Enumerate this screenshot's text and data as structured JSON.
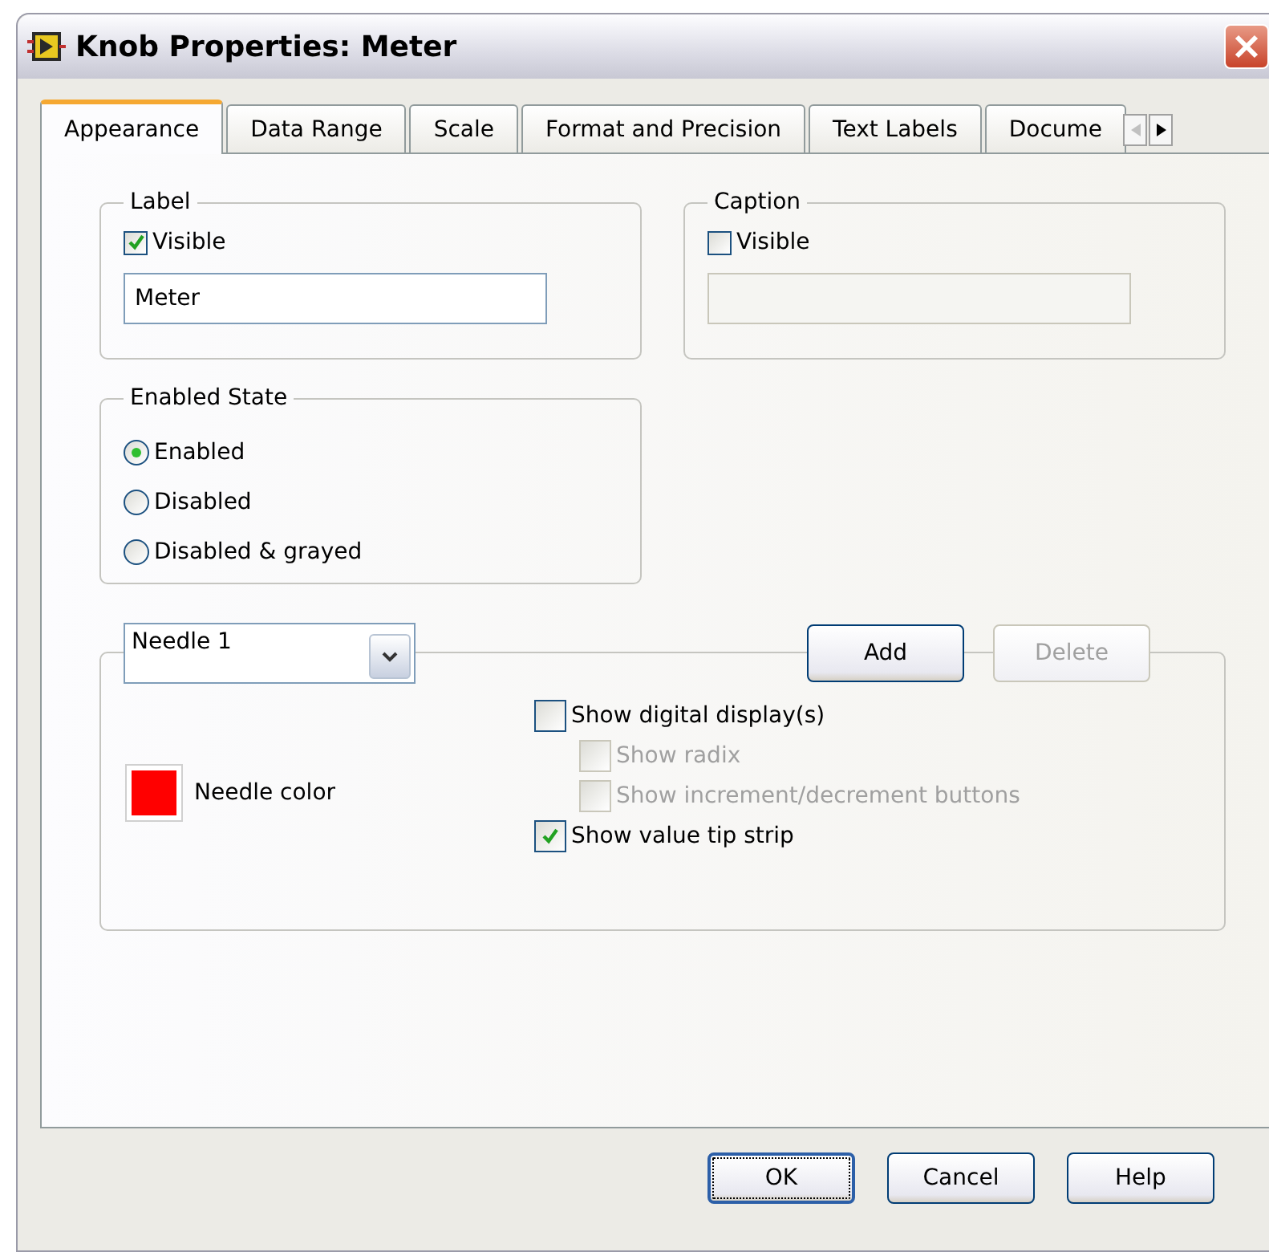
{
  "window": {
    "title": "Knob Properties: Meter"
  },
  "tabs": [
    {
      "label": "Appearance",
      "selected": true
    },
    {
      "label": "Data Range",
      "selected": false
    },
    {
      "label": "Scale",
      "selected": false
    },
    {
      "label": "Format and Precision",
      "selected": false
    },
    {
      "label": "Text Labels",
      "selected": false
    },
    {
      "label": "Docume",
      "selected": false
    }
  ],
  "label_group": {
    "title": "Label",
    "visible": {
      "label": "Visible",
      "checked": true
    },
    "value": "Meter"
  },
  "caption_group": {
    "title": "Caption",
    "visible": {
      "label": "Visible",
      "checked": false
    },
    "disabled": true
  },
  "enabled_state": {
    "title": "Enabled State",
    "options": [
      {
        "label": "Enabled",
        "selected": true
      },
      {
        "label": "Disabled",
        "selected": false
      },
      {
        "label": "Disabled & grayed",
        "selected": false
      }
    ]
  },
  "needle": {
    "dropdown": "Needle 1",
    "add": {
      "label": "Add",
      "disabled": false
    },
    "delete": {
      "label": "Delete",
      "disabled": true
    },
    "color_label": "Needle color",
    "color": "#ff0000",
    "options": [
      {
        "label": "Show digital display(s)",
        "checked": false,
        "disabled": false,
        "children": [
          {
            "label": "Show radix",
            "checked": false,
            "disabled": true
          },
          {
            "label": "Show increment/decrement buttons",
            "checked": false,
            "disabled": true
          }
        ]
      },
      {
        "label": "Show value tip strip",
        "checked": true,
        "disabled": false
      }
    ]
  },
  "buttons": [
    {
      "label": "OK",
      "default": true
    },
    {
      "label": "Cancel",
      "default": false
    },
    {
      "label": "Help",
      "default": false
    }
  ]
}
